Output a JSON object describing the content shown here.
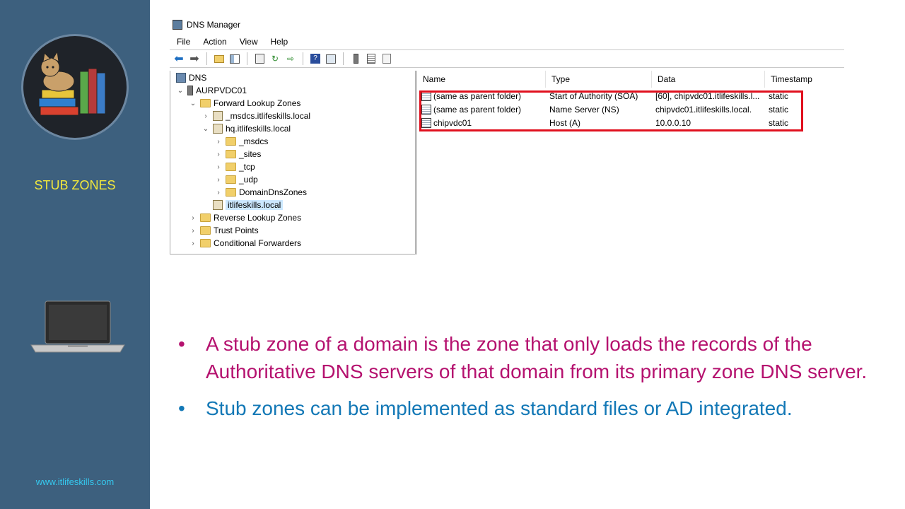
{
  "sidebar": {
    "title": "STUB ZONES",
    "url": "www.itlifeskills.com"
  },
  "window": {
    "title": "DNS Manager",
    "menu": [
      "File",
      "Action",
      "View",
      "Help"
    ]
  },
  "tree": {
    "root": "DNS",
    "server": "AURPVDC01",
    "forward_zones": "Forward Lookup Zones",
    "msdcs_zone": "_msdcs.itlifeskills.local",
    "hq_zone": "hq.itlifeskills.local",
    "hq_children": [
      "_msdcs",
      "_sites",
      "_tcp",
      "_udp",
      "DomainDnsZones"
    ],
    "stub_zone": "itlifeskills.local",
    "reverse_zones": "Reverse Lookup Zones",
    "trust_points": "Trust Points",
    "conditional_forwarders": "Conditional Forwarders"
  },
  "list": {
    "columns": [
      "Name",
      "Type",
      "Data",
      "Timestamp"
    ],
    "rows": [
      {
        "name": "(same as parent folder)",
        "type": "Start of Authority (SOA)",
        "data": "[60], chipvdc01.itlifeskills.l...",
        "timestamp": "static"
      },
      {
        "name": "(same as parent folder)",
        "type": "Name Server (NS)",
        "data": "chipvdc01.itlifeskills.local.",
        "timestamp": "static"
      },
      {
        "name": "chipvdc01",
        "type": "Host (A)",
        "data": "10.0.0.10",
        "timestamp": "static"
      }
    ]
  },
  "bullets": [
    "A stub zone of a domain is the zone that only loads the records of the Authoritative DNS servers of that domain from its primary zone DNS server.",
    "Stub zones can be implemented as standard files or AD integrated."
  ],
  "colors": {
    "sidebar": "#3d607e",
    "title": "#f3e93b",
    "url": "#35c8ee",
    "bullet1": "#b5126f",
    "bullet2": "#1378b6",
    "highlight": "#e0101e"
  }
}
